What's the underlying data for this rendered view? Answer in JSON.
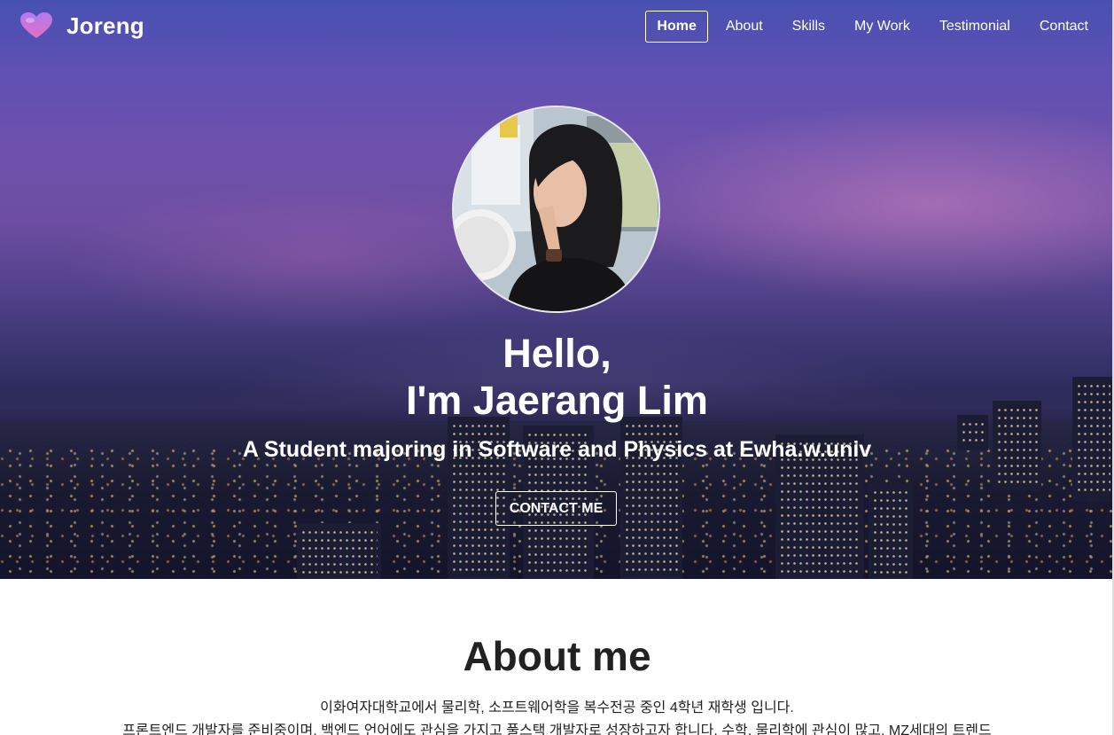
{
  "nav": {
    "brand": "Joreng",
    "items": [
      {
        "label": "Home",
        "active": true
      },
      {
        "label": "About",
        "active": false
      },
      {
        "label": "Skills",
        "active": false
      },
      {
        "label": "My Work",
        "active": false
      },
      {
        "label": "Testimonial",
        "active": false
      },
      {
        "label": "Contact",
        "active": false
      }
    ]
  },
  "hero": {
    "greeting": "Hello,",
    "name_line": "I'm Jaerang Lim",
    "subtitle": "A Student majoring in Software and Physics at Ewha.w.univ",
    "cta_label": "CONTACT ME",
    "avatar_icon": "profile-photo"
  },
  "about": {
    "title": "About me",
    "lines": [
      "이화여자대학교에서 물리학, 소프트웨어학을 복수전공 중인 4학년 재학생 입니다.",
      "프론트엔드 개발자를 준비중이며, 백엔드 언어에도 관심을 가지고 풀스택 개발자로 성장하고자 합니다. 수학, 물리학에 관심이 많고, MZ세대의 트렌드"
    ]
  },
  "colors": {
    "brand_heart_top": "#9b6ee8",
    "brand_heart_bottom": "#e86fc9",
    "text_dark": "#222222"
  }
}
